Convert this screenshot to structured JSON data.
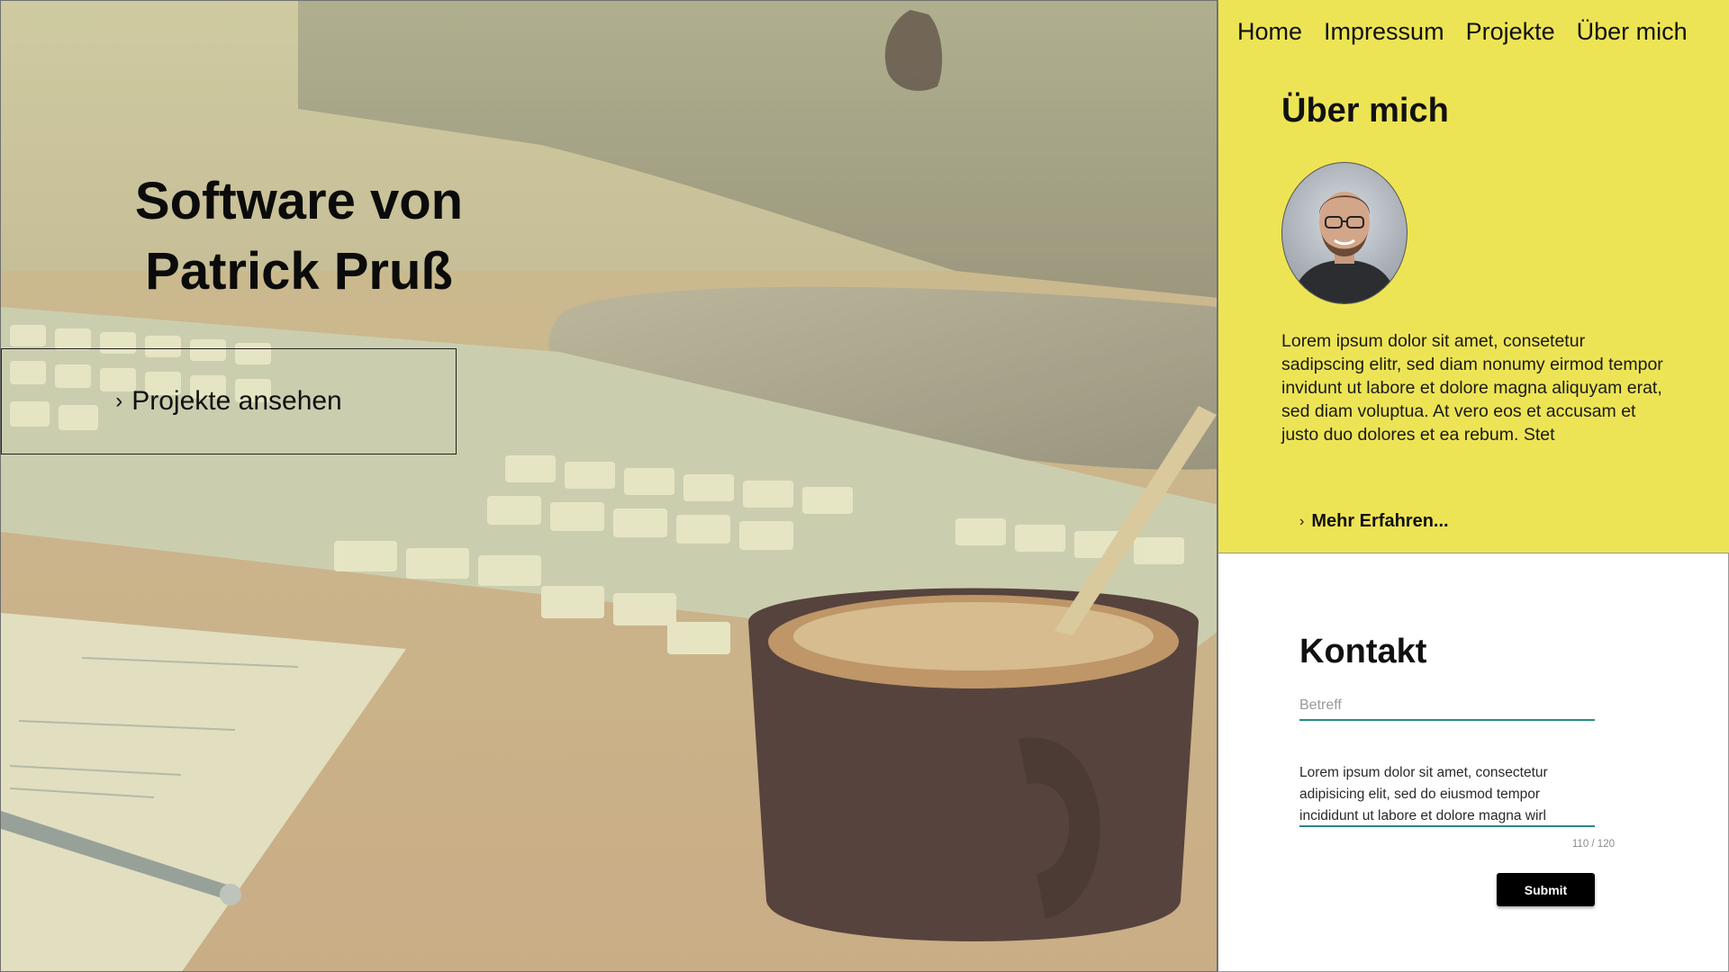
{
  "hero": {
    "title_line1": "Software von",
    "title_line2": "Patrick Pruß",
    "button_label": "Projekte ansehen"
  },
  "nav": {
    "items": [
      "Home",
      "Impressum",
      "Projekte",
      "Über mich"
    ]
  },
  "about": {
    "heading": "Über mich",
    "text": "Lorem ipsum dolor sit amet, consetetur sadipscing elitr, sed diam nonumy eirmod tempor invidunt ut labore et dolore magna aliquyam erat, sed diam voluptua. At vero eos et accusam et justo duo dolores et ea rebum. Stet",
    "more_label": "Mehr Erfahren..."
  },
  "contact": {
    "heading": "Kontakt",
    "subject_placeholder": "Betreff",
    "message_value": "Lorem ipsum dolor sit amet, consectetur adipisicing elit, sed do eiusmod tempor incididunt ut labore et dolore magna wirl",
    "counter": "110 / 120",
    "submit_label": "Submit"
  },
  "colors": {
    "about_bg": "#ede455",
    "accent_underline": "#2a8a86",
    "submit_bg": "#000000"
  },
  "icons": {
    "hero_button": "chevron-right-icon",
    "more_link": "chevron-right-icon"
  }
}
